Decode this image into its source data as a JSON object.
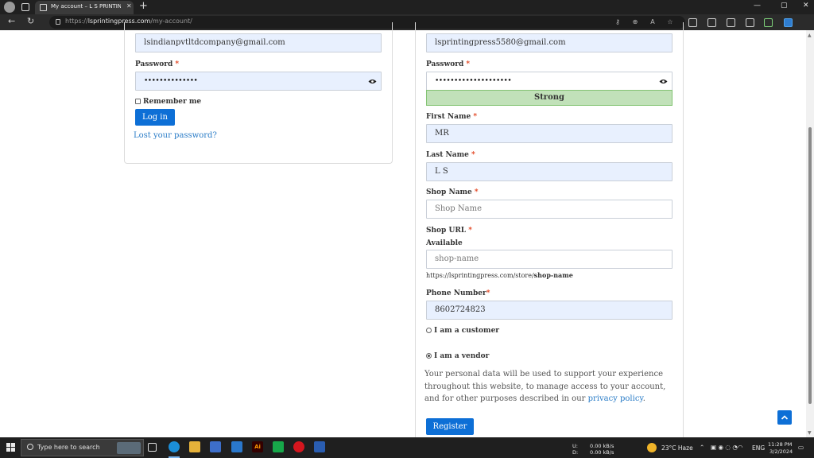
{
  "browser": {
    "tab_title": "My account – L S PRINTING PRES",
    "tab_close": "✕",
    "new_tab": "+",
    "url_host": "lsprintingpress.com",
    "url_path": "/my-account/",
    "url_scheme": "https://",
    "back": "←",
    "refresh": "↻",
    "minimize": "—",
    "maximize": "▢",
    "close": "✕"
  },
  "login": {
    "email_value": "lsindianpvtltdcompany@gmail.com",
    "password_label": "Password",
    "password_dots": "••••••••••••••",
    "required_mark": "*",
    "remember_label": "Remember me",
    "login_button": "Log in",
    "lost_password": "Lost your password?"
  },
  "register": {
    "email_value": "lsprintingpress5580@gmail.com",
    "password_label": "Password",
    "password_dots": "••••••••••••••••••••",
    "strength": "Strong",
    "first_name_label": "First Name",
    "first_name_value": "MR",
    "last_name_label": "Last Name",
    "last_name_value": "L S",
    "shop_name_label": "Shop Name",
    "shop_name_placeholder": "Shop Name",
    "shop_url_label": "Shop URL",
    "shop_url_status": "Available",
    "shop_url_placeholder": "shop-name",
    "shop_url_prefix": "https://lsprintingpress.com/store/",
    "shop_url_slug": "shop-name",
    "phone_label": "Phone Number",
    "phone_value": "8602724823",
    "role_customer": "I am a customer",
    "role_vendor": "I am a vendor",
    "privacy_text": "Your personal data will be used to support your experience throughout this website, to manage access to your account, and for other purposes described in our ",
    "privacy_link": "privacy policy",
    "privacy_end": ".",
    "register_button": "Register"
  },
  "taskbar": {
    "search_placeholder": "Type here to search",
    "net_up_label": "U:",
    "net_down_label": "D:",
    "net_up": "0.00 kB/s",
    "net_down": "0.00 kB/s",
    "weather": "23°C  Haze",
    "lang": "ENG",
    "time": "11:28 PM",
    "date": "3/2/2024",
    "illustrator_label": "Ai"
  },
  "colors": {
    "accent": "#0d6fd6",
    "link": "#2a7cc7",
    "strong_bg": "#c1e1b9",
    "required": "#e2401c",
    "field_bg": "#e8f0fe"
  }
}
